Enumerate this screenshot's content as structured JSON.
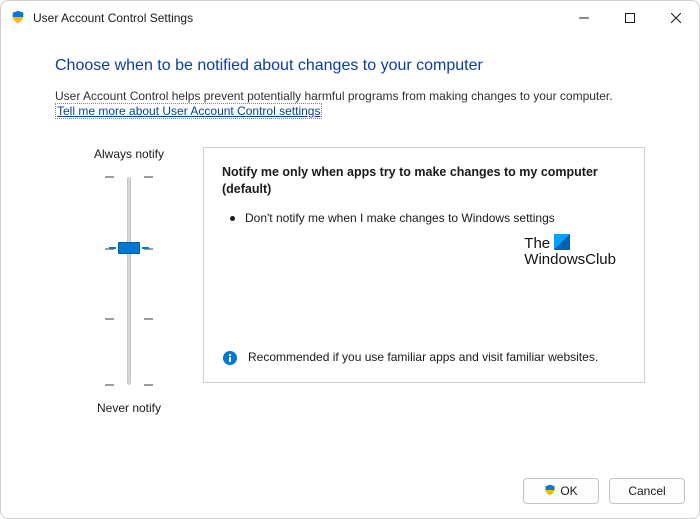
{
  "window": {
    "title": "User Account Control Settings"
  },
  "heading": "Choose when to be notified about changes to your computer",
  "description": "User Account Control helps prevent potentially harmful programs from making changes to your computer.",
  "link": "Tell me more about User Account Control settings",
  "slider": {
    "top_label": "Always notify",
    "bottom_label": "Never notify",
    "levels": 4,
    "current_level": 1
  },
  "panel": {
    "title": "Notify me only when apps try to make changes to my computer (default)",
    "bullet": "Don't notify me when I make changes to Windows settings",
    "recommendation": "Recommended if you use familiar apps and visit familiar websites."
  },
  "watermark": {
    "line1": "The",
    "line2": "WindowsClub"
  },
  "footer": {
    "ok": "OK",
    "cancel": "Cancel"
  }
}
